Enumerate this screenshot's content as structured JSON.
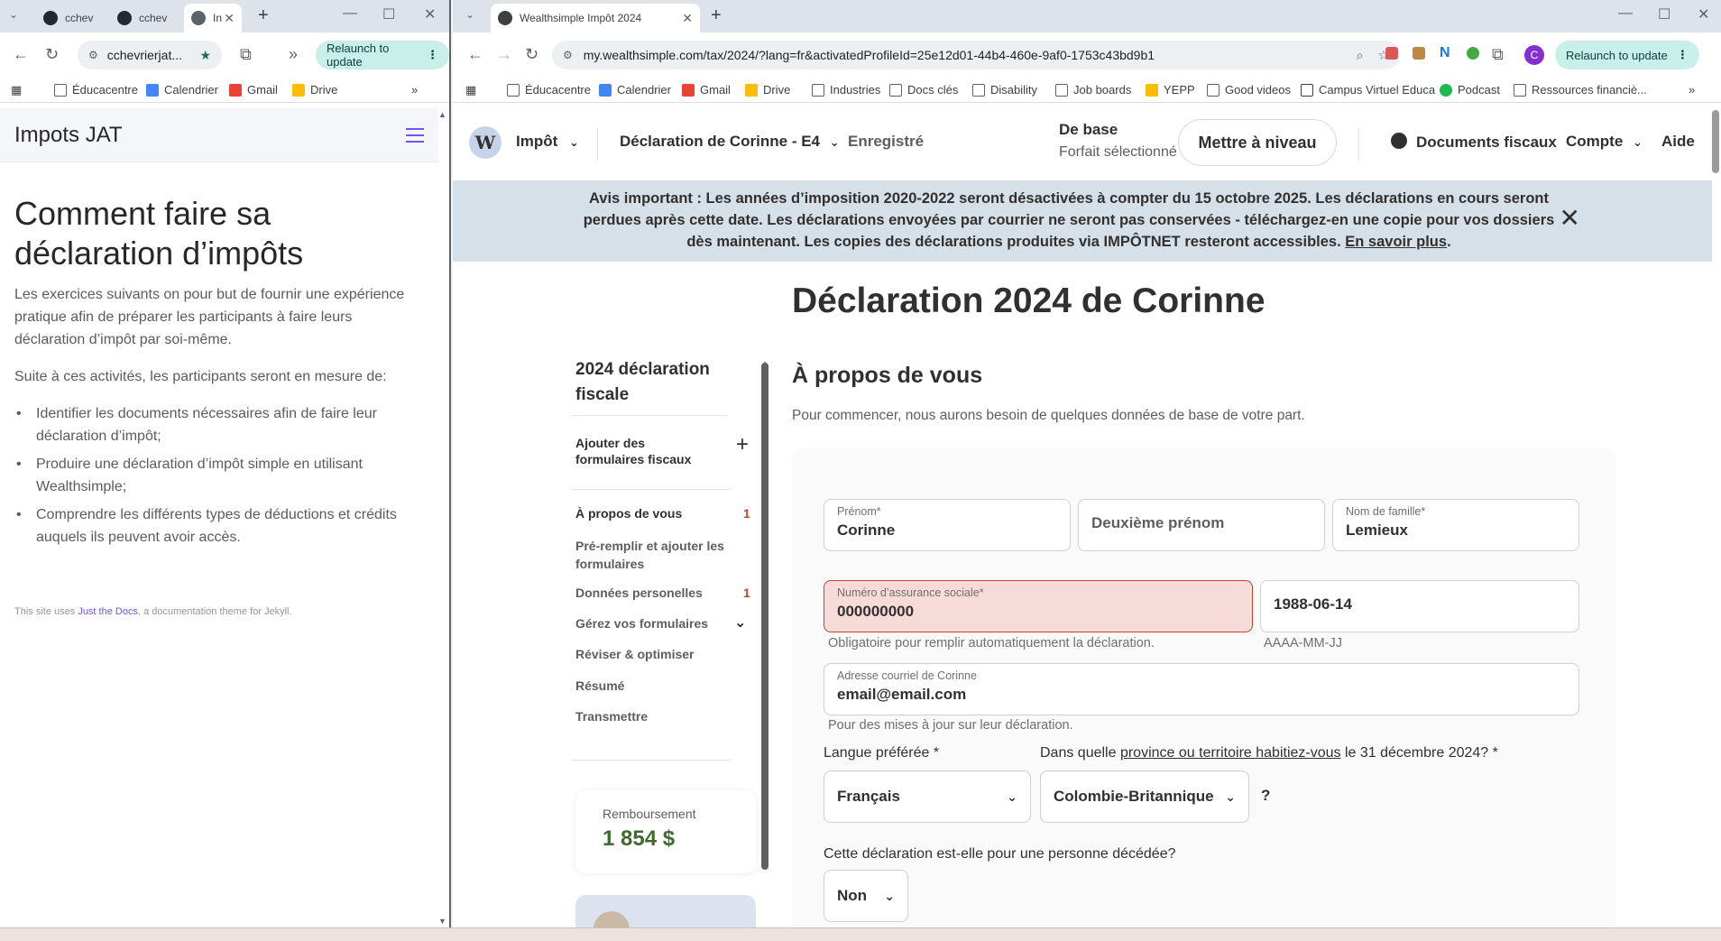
{
  "left_window": {
    "tabs": [
      {
        "label": "cchev"
      },
      {
        "label": "cchev"
      },
      {
        "label": "In"
      }
    ],
    "address": "cchevrierjat...",
    "relaunch": "Relaunch to update",
    "bookmarks": [
      "Éducacentre",
      "Calendrier",
      "Gmail",
      "Drive"
    ],
    "site_title": "Impots JAT",
    "heading": "Comment faire sa déclaration d’impôts",
    "intro": "Les exercices suivants on pour but de fournir une expérience pratique afin de préparer les participants à faire leurs déclaration d’impôt par soi-même.",
    "followup": "Suite à ces activités, les participants seront en mesure de:",
    "list": [
      "Identifier les documents nécessaires afin de faire leur déclaration d’impôt;",
      "Produire une déclaration d’impôt simple en utilisant Wealthsimple;",
      "Comprendre les différents types de déductions et crédits auquels ils peuvent avoir accès."
    ],
    "footer_pre": "This site uses ",
    "footer_link": "Just the Docs",
    "footer_post": ", a documentation theme for Jekyll."
  },
  "right_window": {
    "tab_title": "Wealthsimple Impôt 2024",
    "url": "my.wealthsimple.com/tax/2024/?lang=fr&activatedProfileId=25e12d01-44b4-460e-9af0-1753c43bd9b1",
    "relaunch": "Relaunch to update",
    "profile_initial": "C",
    "bookmarks": [
      "Éducacentre",
      "Calendrier",
      "Gmail",
      "Drive",
      "Industries",
      "Docs clés",
      "Disability",
      "Job boards",
      "YEPP",
      "Good videos",
      "Campus Virtuel Educa",
      "Podcast",
      "Ressources financiè..."
    ],
    "nav": {
      "logo": "W",
      "impot": "Impôt",
      "declaration": "Déclaration de Corinne - E4",
      "saved": "Enregistré",
      "plan_title": "De base",
      "plan_sub": "Forfait sélectionné",
      "upgrade": "Mettre à niveau",
      "docs": "Documents fiscaux",
      "account": "Compte",
      "help": "Aide"
    },
    "banner": {
      "text": "Avis important : Les années d’imposition 2020-2022 seront désactivées à compter du 15 octobre 2025. Les déclarations en cours seront perdues après cette date. Les déclarations envoyées par courrier ne seront pas conservées - téléchargez-en une copie pour vos dossiers dès maintenant. Les copies des déclarations produites via IMPÔTNET resteront accessibles.",
      "link": "En savoir plus",
      "end": "."
    },
    "page_title": "Déclaration 2024 de Corinne",
    "sidebar": {
      "title": "2024 déclaration fiscale",
      "add_forms": "Ajouter des formulaires fiscaux",
      "items": [
        {
          "label": "À propos de vous",
          "count": "1"
        },
        {
          "label": "Pré-remplir et ajouter les formulaires",
          "count": ""
        },
        {
          "label": "Données personelles",
          "count": "1"
        },
        {
          "label": "Gérez vos formulaires",
          "count": ""
        },
        {
          "label": "Réviser & optimiser",
          "count": ""
        },
        {
          "label": "Résumé",
          "count": ""
        },
        {
          "label": "Transmettre",
          "count": ""
        }
      ],
      "refund_label": "Remboursement",
      "refund_value": "1 854 $"
    },
    "section": {
      "title": "À propos de vous",
      "subtitle": "Pour commencer, nous aurons besoin de quelques données de base de votre part."
    },
    "form": {
      "first_name_label": "Prénom*",
      "first_name": "Corinne",
      "middle_name_placeholder": "Deuxième prénom",
      "last_name_label": "Nom de famille*",
      "last_name": "Lemieux",
      "sin_label": "Numéro d’assurance sociale*",
      "sin": "000000000",
      "sin_help": "Obligatoire pour remplir automatiquement la déclaration.",
      "dob": "1988-06-14",
      "dob_help": "AAAA-MM-JJ",
      "email_label": "Adresse courriel de Corinne",
      "email": "email@email.com",
      "email_help": "Pour des mises à jour sur leur déclaration.",
      "language_label": "Langue préférée",
      "required_star": "*",
      "language": "Français",
      "province_q_pre": "Dans quelle ",
      "province_q_link": "province ou territoire habitiez-vous",
      "province_q_post": " le 31 décembre 2024?",
      "province": "Colombie-Britannique",
      "province_help": "?",
      "deceased_q": "Cette déclaration est-elle pour une personne décédée?",
      "deceased": "Non"
    }
  }
}
